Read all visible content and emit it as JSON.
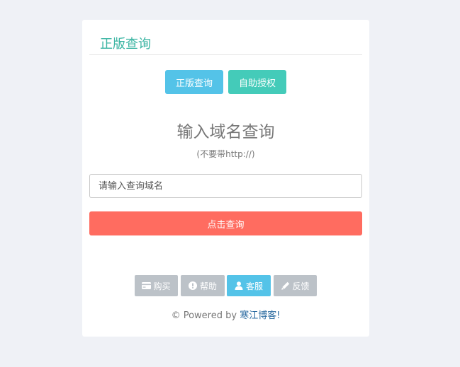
{
  "card": {
    "title": "正版查询"
  },
  "tabs": {
    "genuine_label": "正版查询",
    "auth_label": "自助授权"
  },
  "query": {
    "heading": "输入域名查询",
    "subheading": "(不要带http://)",
    "placeholder": "请输入查询域名",
    "value": "",
    "submit_label": "点击查询"
  },
  "actions": {
    "buy_label": "购买",
    "help_label": "帮助",
    "service_label": "客服",
    "feedback_label": "反馈"
  },
  "footer": {
    "prefix": "© Powered by ",
    "link_text": "寒江博客!"
  },
  "colors": {
    "title": "#3bb5a3",
    "genuine_button": "#54c3e8",
    "auth_button": "#44cbb9",
    "query_button": "#ff6c60",
    "service_button": "#54c3e8",
    "grey_button": "#bcc2c8",
    "link": "#2a6aa0"
  },
  "icons": {
    "buy": "credit-card-icon",
    "help": "exclamation-circle-icon",
    "service": "user-icon",
    "feedback": "pencil-icon"
  }
}
